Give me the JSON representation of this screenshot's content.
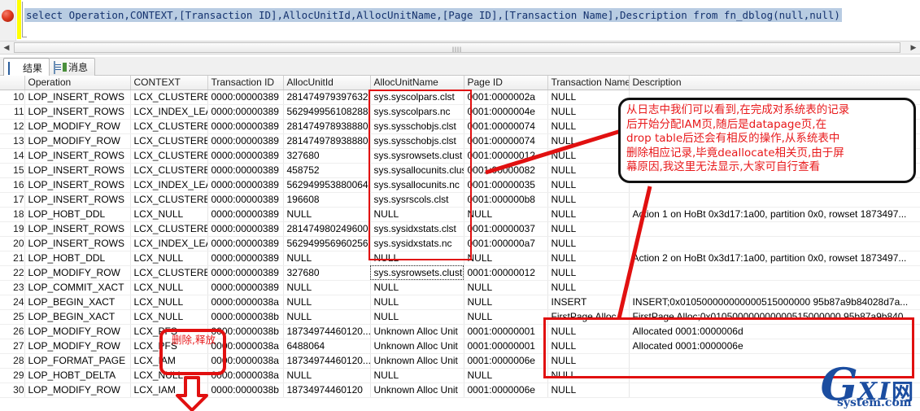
{
  "editor": {
    "sql": "select Operation,CONTEXT,[Transaction ID],AllocUnitId,AllocUnitName,[Page ID],[Transaction Name],Description from fn_dblog(null,null)",
    "breakpoint_icon": "breakpoint-icon",
    "scroll_grip": "llll"
  },
  "scrollbar": {
    "left_arrow": "◀",
    "right_arrow": "▶"
  },
  "tabs": [
    {
      "label": "结果",
      "icon": "results-grid-icon",
      "active": true
    },
    {
      "label": "消息",
      "icon": "messages-icon",
      "active": false
    }
  ],
  "grid": {
    "columns": [
      {
        "key": "num",
        "label": ""
      },
      {
        "key": "op",
        "label": "Operation"
      },
      {
        "key": "ctx",
        "label": "CONTEXT"
      },
      {
        "key": "txid",
        "label": "Transaction ID"
      },
      {
        "key": "auid",
        "label": "AllocUnitId"
      },
      {
        "key": "aun",
        "label": "AllocUnitName"
      },
      {
        "key": "pid",
        "label": "Page ID"
      },
      {
        "key": "tn",
        "label": "Transaction Name"
      },
      {
        "key": "desc",
        "label": "Description"
      }
    ],
    "rows": [
      {
        "num": "10",
        "op": "LOP_INSERT_ROWS",
        "ctx": "LCX_CLUSTERED",
        "txid": "0000:00000389",
        "auid": "281474979397632",
        "aun": "sys.syscolpars.clst",
        "pid": "0001:0000002a",
        "tn": "NULL",
        "desc": ""
      },
      {
        "num": "11",
        "op": "LOP_INSERT_ROWS",
        "ctx": "LCX_INDEX_LEAF",
        "txid": "0000:00000389",
        "auid": "562949956108288",
        "aun": "sys.syscolpars.nc",
        "pid": "0001:0000004e",
        "tn": "NULL",
        "desc": ""
      },
      {
        "num": "12",
        "op": "LOP_MODIFY_ROW",
        "ctx": "LCX_CLUSTERED",
        "txid": "0000:00000389",
        "auid": "281474978938880",
        "aun": "sys.sysschobjs.clst",
        "pid": "0001:00000074",
        "tn": "NULL",
        "desc": ""
      },
      {
        "num": "13",
        "op": "LOP_MODIFY_ROW",
        "ctx": "LCX_CLUSTERED",
        "txid": "0000:00000389",
        "auid": "281474978938880",
        "aun": "sys.sysschobjs.clst",
        "pid": "0001:00000074",
        "tn": "NULL",
        "desc": ""
      },
      {
        "num": "14",
        "op": "LOP_INSERT_ROWS",
        "ctx": "LCX_CLUSTERED",
        "txid": "0000:00000389",
        "auid": "327680",
        "aun": "sys.sysrowsets.clust",
        "pid": "0001:00000012",
        "tn": "NULL",
        "desc": ""
      },
      {
        "num": "15",
        "op": "LOP_INSERT_ROWS",
        "ctx": "LCX_CLUSTERED",
        "txid": "0000:00000389",
        "auid": "458752",
        "aun": "sys.sysallocunits.clust",
        "pid": "0001:00000082",
        "tn": "NULL",
        "desc": ""
      },
      {
        "num": "16",
        "op": "LOP_INSERT_ROWS",
        "ctx": "LCX_INDEX_LEAF",
        "txid": "0000:00000389",
        "auid": "562949953880064",
        "aun": "sys.sysallocunits.nc",
        "pid": "0001:00000035",
        "tn": "NULL",
        "desc": ""
      },
      {
        "num": "17",
        "op": "LOP_INSERT_ROWS",
        "ctx": "LCX_CLUSTERED",
        "txid": "0000:00000389",
        "auid": "196608",
        "aun": "sys.sysrscols.clst",
        "pid": "0001:000000b8",
        "tn": "NULL",
        "desc": ""
      },
      {
        "num": "18",
        "op": "LOP_HOBT_DDL",
        "ctx": "LCX_NULL",
        "txid": "0000:00000389",
        "auid": "NULL",
        "aun": "NULL",
        "pid": "NULL",
        "tn": "NULL",
        "desc": "Action 1 on HoBt 0x3d17:1a00, partition 0x0, rowset 1873497..."
      },
      {
        "num": "19",
        "op": "LOP_INSERT_ROWS",
        "ctx": "LCX_CLUSTERED",
        "txid": "0000:00000389",
        "auid": "281474980249600",
        "aun": "sys.sysidxstats.clst",
        "pid": "0001:00000037",
        "tn": "NULL",
        "desc": ""
      },
      {
        "num": "20",
        "op": "LOP_INSERT_ROWS",
        "ctx": "LCX_INDEX_LEAF",
        "txid": "0000:00000389",
        "auid": "562949956960256",
        "aun": "sys.sysidxstats.nc",
        "pid": "0001:000000a7",
        "tn": "NULL",
        "desc": ""
      },
      {
        "num": "21",
        "op": "LOP_HOBT_DDL",
        "ctx": "LCX_NULL",
        "txid": "0000:00000389",
        "auid": "NULL",
        "aun": "NULL",
        "pid": "NULL",
        "tn": "NULL",
        "desc": "Action 2 on HoBt 0x3d17:1a00, partition 0x0, rowset 1873497..."
      },
      {
        "num": "22",
        "op": "LOP_MODIFY_ROW",
        "ctx": "LCX_CLUSTERED",
        "txid": "0000:00000389",
        "auid": "327680",
        "aun": "sys.sysrowsets.clust",
        "pid": "0001:00000012",
        "tn": "NULL",
        "desc": "",
        "selected": "aun"
      },
      {
        "num": "23",
        "op": "LOP_COMMIT_XACT",
        "ctx": "LCX_NULL",
        "txid": "0000:00000389",
        "auid": "NULL",
        "aun": "NULL",
        "pid": "NULL",
        "tn": "NULL",
        "desc": ""
      },
      {
        "num": "24",
        "op": "LOP_BEGIN_XACT",
        "ctx": "LCX_NULL",
        "txid": "0000:0000038a",
        "auid": "NULL",
        "aun": "NULL",
        "pid": "NULL",
        "tn": "INSERT",
        "desc": "INSERT;0x010500000000000515000000 95b87a9b84028d7a..."
      },
      {
        "num": "25",
        "op": "LOP_BEGIN_XACT",
        "ctx": "LCX_NULL",
        "txid": "0000:0000038b",
        "auid": "NULL",
        "aun": "NULL",
        "pid": "NULL",
        "tn": "FirstPage Alloc",
        "desc": "FirstPage Alloc;0x010500000000000515000000 95b87a9b840..."
      },
      {
        "num": "26",
        "op": "LOP_MODIFY_ROW",
        "ctx": "LCX_PFS",
        "txid": "0000:0000038b",
        "auid": "18734974460120...",
        "aun": "Unknown Alloc Unit",
        "pid": "0001:00000001",
        "tn": "NULL",
        "desc": "Allocated 0001:0000006d"
      },
      {
        "num": "27",
        "op": "LOP_MODIFY_ROW",
        "ctx": "LCX_PFS",
        "txid": "0000:0000038a",
        "auid": "6488064",
        "aun": "Unknown Alloc Unit",
        "pid": "0001:00000001",
        "tn": "NULL",
        "desc": "Allocated 0001:0000006e"
      },
      {
        "num": "28",
        "op": "LOP_FORMAT_PAGE",
        "ctx": "LCX_IAM",
        "txid": "0000:0000038a",
        "auid": "18734974460120...",
        "aun": "Unknown Alloc Unit",
        "pid": "0001:0000006e",
        "tn": "NULL",
        "desc": ""
      },
      {
        "num": "29",
        "op": "LOP_HOBT_DELTA",
        "ctx": "LCX_NULL",
        "txid": "0000:0000038a",
        "auid": "NULL",
        "aun": "NULL",
        "pid": "NULL",
        "tn": "NULL",
        "desc": ""
      },
      {
        "num": "30",
        "op": "LOP_MODIFY_ROW",
        "ctx": "LCX_IAM",
        "txid": "0000:0000038b",
        "auid": "18734974460120",
        "aun": "Unknown Alloc Unit",
        "pid": "0001:0000006e",
        "tn": "NULL",
        "desc": ""
      }
    ]
  },
  "annotations": {
    "callout_lines": [
      "从日志中我们可以看到,在完成对系统表的记录",
      "后开始分配IAM页,随后是datapage页,在",
      "drop table后还会有相反的操作,从系统表中",
      "删除相应记录,毕竟deallocate相关页,由于屏",
      "幕原因,我这里无法显示,大家可自行查看"
    ],
    "delete_release_label": "删除,释放",
    "colors": {
      "annotation_red": "#e8191b",
      "callout_border": "#111111",
      "selection_blue": "#b3d0e8",
      "null_yellow": "#fcfbe0",
      "sql_highlight": "#b8cce2"
    }
  },
  "watermark": {
    "g": "G",
    "xi": "XI",
    "wang": "网",
    "domain": "system.com"
  }
}
